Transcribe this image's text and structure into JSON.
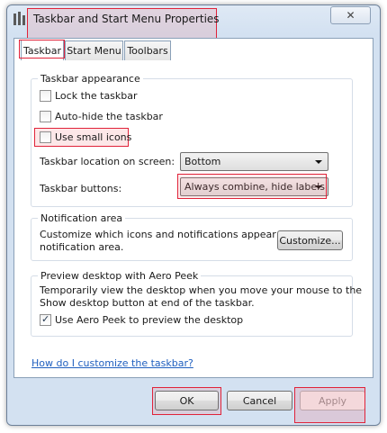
{
  "window": {
    "title": "Taskbar and Start Menu Properties",
    "close_glyph": "✕"
  },
  "tabs": [
    {
      "label": "Taskbar",
      "selected": true
    },
    {
      "label": "Start Menu",
      "selected": false
    },
    {
      "label": "Toolbars",
      "selected": false
    }
  ],
  "appearance": {
    "legend": "Taskbar appearance",
    "lock_label": "Lock the taskbar",
    "lock_checked": false,
    "autohide_label": "Auto-hide the taskbar",
    "autohide_checked": false,
    "small_icons_label": "Use small icons",
    "small_icons_checked": false,
    "location_label": "Taskbar location on screen:",
    "location_value": "Bottom",
    "buttons_label": "Taskbar buttons:",
    "buttons_value": "Always combine, hide labels"
  },
  "notification": {
    "legend": "Notification area",
    "description_line1": "Customize which icons and notifications appear in the",
    "description_line2": "notification area.",
    "customize_button": "Customize..."
  },
  "aero_peek": {
    "legend": "Preview desktop with Aero Peek",
    "description_line1": "Temporarily view the desktop when you move your mouse to the",
    "description_line2": "Show desktop button at end of the taskbar.",
    "checkbox_label": "Use Aero Peek to preview the desktop",
    "checkbox_checked": true
  },
  "help_link": "How do I customize the taskbar?",
  "footer": {
    "ok": "OK",
    "cancel": "Cancel",
    "apply": "Apply",
    "apply_disabled": true
  },
  "colors": {
    "highlight": "#e0233a",
    "link": "#1f5fbf"
  }
}
